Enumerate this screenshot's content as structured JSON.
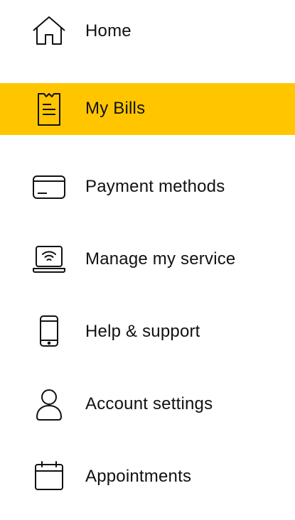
{
  "menu": {
    "accent_color": "#FFC600",
    "active_index": 1,
    "items": [
      {
        "label": "Home",
        "icon": "home-icon"
      },
      {
        "label": "My Bills",
        "icon": "receipt-icon"
      },
      {
        "label": "Payment methods",
        "icon": "credit-card-icon"
      },
      {
        "label": "Manage my service",
        "icon": "laptop-wifi-icon"
      },
      {
        "label": "Help & support",
        "icon": "mobile-phone-icon"
      },
      {
        "label": "Account settings",
        "icon": "user-icon"
      },
      {
        "label": "Appointments",
        "icon": "calendar-icon"
      }
    ]
  }
}
